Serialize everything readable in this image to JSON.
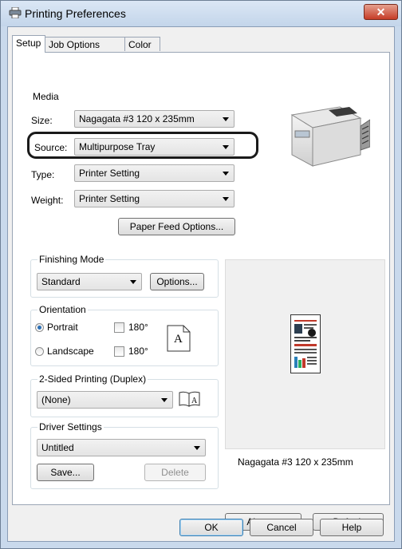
{
  "window": {
    "title": "Printing Preferences",
    "close_glyph": "✕"
  },
  "tabs": [
    "Setup",
    "Job Options",
    "Color"
  ],
  "media": {
    "group_label": "Media",
    "size_label": "Size:",
    "size_value": "Nagagata #3 120 x 235mm",
    "source_label": "Source:",
    "source_value": "Multipurpose Tray",
    "type_label": "Type:",
    "type_value": "Printer Setting",
    "weight_label": "Weight:",
    "weight_value": "Printer Setting",
    "paper_feed_button": "Paper Feed Options..."
  },
  "finishing": {
    "group_label": "Finishing Mode",
    "value": "Standard",
    "options_button": "Options..."
  },
  "orientation": {
    "group_label": "Orientation",
    "portrait_label": "Portrait",
    "landscape_label": "Landscape",
    "rotate_label": "180°",
    "portrait_selected": true,
    "preview_letter": "A"
  },
  "duplex": {
    "group_label": "2-Sided Printing (Duplex)",
    "value": "(None)"
  },
  "driver_settings": {
    "group_label": "Driver Settings",
    "value": "Untitled",
    "save_button": "Save...",
    "delete_button": "Delete"
  },
  "preview": {
    "caption": "Nagagata #3 120 x 235mm"
  },
  "panel_buttons": {
    "about": "About...",
    "default": "Default"
  },
  "dialog_buttons": {
    "ok": "OK",
    "cancel": "Cancel",
    "help": "Help"
  },
  "colors": {
    "titlebar": "#c9d9ec",
    "close_button": "#c63c27",
    "highlight_outline": "#1a1a1a",
    "radio_selected": "#2b6fb6"
  },
  "icons": [
    "printer-icon",
    "close-icon",
    "printer-device-image",
    "portrait-page-icon",
    "booklet-icon",
    "dropdown-arrow-icon"
  ]
}
